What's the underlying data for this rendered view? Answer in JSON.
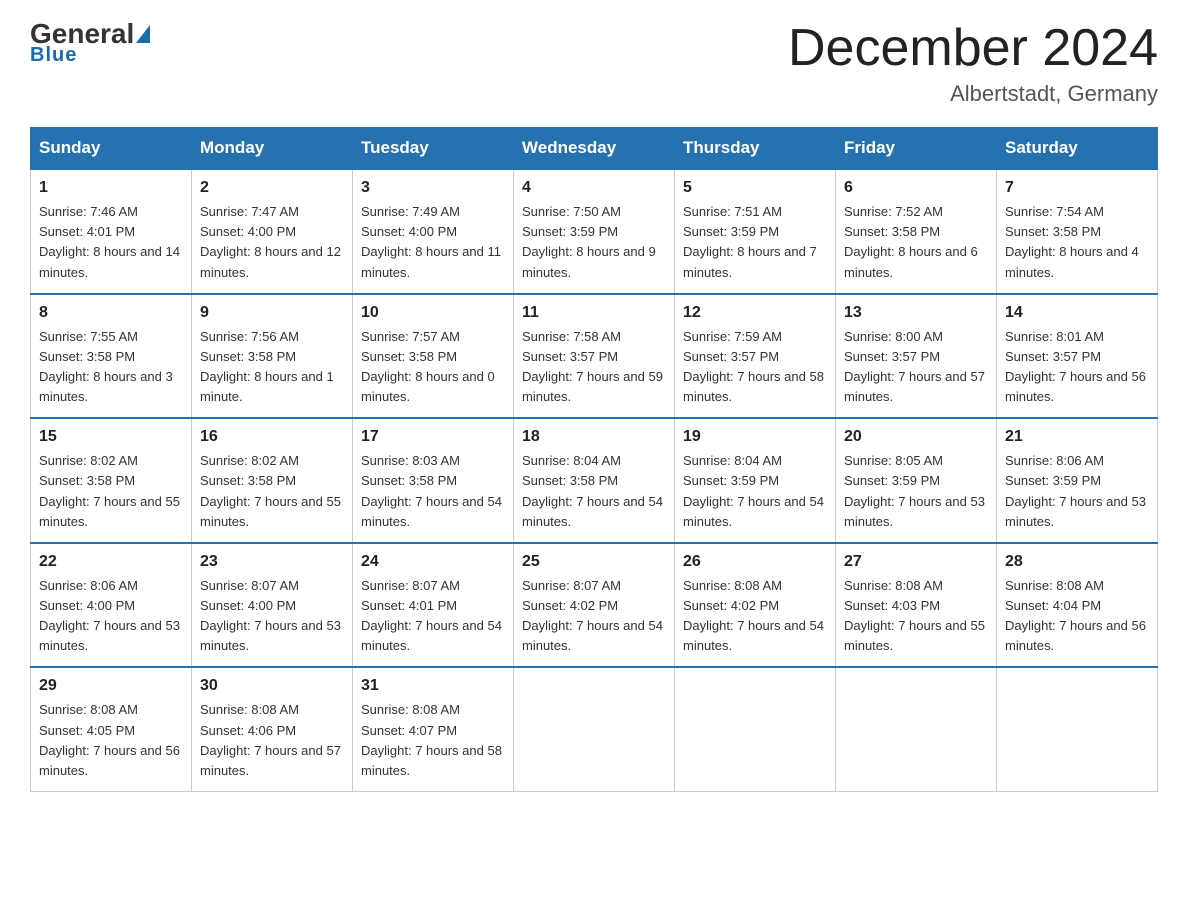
{
  "header": {
    "logo_general": "General",
    "logo_blue": "Blue",
    "title": "December 2024",
    "subtitle": "Albertstadt, Germany"
  },
  "days_of_week": [
    "Sunday",
    "Monday",
    "Tuesday",
    "Wednesday",
    "Thursday",
    "Friday",
    "Saturday"
  ],
  "weeks": [
    [
      {
        "day": "1",
        "sunrise": "7:46 AM",
        "sunset": "4:01 PM",
        "daylight": "8 hours and 14 minutes."
      },
      {
        "day": "2",
        "sunrise": "7:47 AM",
        "sunset": "4:00 PM",
        "daylight": "8 hours and 12 minutes."
      },
      {
        "day": "3",
        "sunrise": "7:49 AM",
        "sunset": "4:00 PM",
        "daylight": "8 hours and 11 minutes."
      },
      {
        "day": "4",
        "sunrise": "7:50 AM",
        "sunset": "3:59 PM",
        "daylight": "8 hours and 9 minutes."
      },
      {
        "day": "5",
        "sunrise": "7:51 AM",
        "sunset": "3:59 PM",
        "daylight": "8 hours and 7 minutes."
      },
      {
        "day": "6",
        "sunrise": "7:52 AM",
        "sunset": "3:58 PM",
        "daylight": "8 hours and 6 minutes."
      },
      {
        "day": "7",
        "sunrise": "7:54 AM",
        "sunset": "3:58 PM",
        "daylight": "8 hours and 4 minutes."
      }
    ],
    [
      {
        "day": "8",
        "sunrise": "7:55 AM",
        "sunset": "3:58 PM",
        "daylight": "8 hours and 3 minutes."
      },
      {
        "day": "9",
        "sunrise": "7:56 AM",
        "sunset": "3:58 PM",
        "daylight": "8 hours and 1 minute."
      },
      {
        "day": "10",
        "sunrise": "7:57 AM",
        "sunset": "3:58 PM",
        "daylight": "8 hours and 0 minutes."
      },
      {
        "day": "11",
        "sunrise": "7:58 AM",
        "sunset": "3:57 PM",
        "daylight": "7 hours and 59 minutes."
      },
      {
        "day": "12",
        "sunrise": "7:59 AM",
        "sunset": "3:57 PM",
        "daylight": "7 hours and 58 minutes."
      },
      {
        "day": "13",
        "sunrise": "8:00 AM",
        "sunset": "3:57 PM",
        "daylight": "7 hours and 57 minutes."
      },
      {
        "day": "14",
        "sunrise": "8:01 AM",
        "sunset": "3:57 PM",
        "daylight": "7 hours and 56 minutes."
      }
    ],
    [
      {
        "day": "15",
        "sunrise": "8:02 AM",
        "sunset": "3:58 PM",
        "daylight": "7 hours and 55 minutes."
      },
      {
        "day": "16",
        "sunrise": "8:02 AM",
        "sunset": "3:58 PM",
        "daylight": "7 hours and 55 minutes."
      },
      {
        "day": "17",
        "sunrise": "8:03 AM",
        "sunset": "3:58 PM",
        "daylight": "7 hours and 54 minutes."
      },
      {
        "day": "18",
        "sunrise": "8:04 AM",
        "sunset": "3:58 PM",
        "daylight": "7 hours and 54 minutes."
      },
      {
        "day": "19",
        "sunrise": "8:04 AM",
        "sunset": "3:59 PM",
        "daylight": "7 hours and 54 minutes."
      },
      {
        "day": "20",
        "sunrise": "8:05 AM",
        "sunset": "3:59 PM",
        "daylight": "7 hours and 53 minutes."
      },
      {
        "day": "21",
        "sunrise": "8:06 AM",
        "sunset": "3:59 PM",
        "daylight": "7 hours and 53 minutes."
      }
    ],
    [
      {
        "day": "22",
        "sunrise": "8:06 AM",
        "sunset": "4:00 PM",
        "daylight": "7 hours and 53 minutes."
      },
      {
        "day": "23",
        "sunrise": "8:07 AM",
        "sunset": "4:00 PM",
        "daylight": "7 hours and 53 minutes."
      },
      {
        "day": "24",
        "sunrise": "8:07 AM",
        "sunset": "4:01 PM",
        "daylight": "7 hours and 54 minutes."
      },
      {
        "day": "25",
        "sunrise": "8:07 AM",
        "sunset": "4:02 PM",
        "daylight": "7 hours and 54 minutes."
      },
      {
        "day": "26",
        "sunrise": "8:08 AM",
        "sunset": "4:02 PM",
        "daylight": "7 hours and 54 minutes."
      },
      {
        "day": "27",
        "sunrise": "8:08 AM",
        "sunset": "4:03 PM",
        "daylight": "7 hours and 55 minutes."
      },
      {
        "day": "28",
        "sunrise": "8:08 AM",
        "sunset": "4:04 PM",
        "daylight": "7 hours and 56 minutes."
      }
    ],
    [
      {
        "day": "29",
        "sunrise": "8:08 AM",
        "sunset": "4:05 PM",
        "daylight": "7 hours and 56 minutes."
      },
      {
        "day": "30",
        "sunrise": "8:08 AM",
        "sunset": "4:06 PM",
        "daylight": "7 hours and 57 minutes."
      },
      {
        "day": "31",
        "sunrise": "8:08 AM",
        "sunset": "4:07 PM",
        "daylight": "7 hours and 58 minutes."
      },
      null,
      null,
      null,
      null
    ]
  ]
}
